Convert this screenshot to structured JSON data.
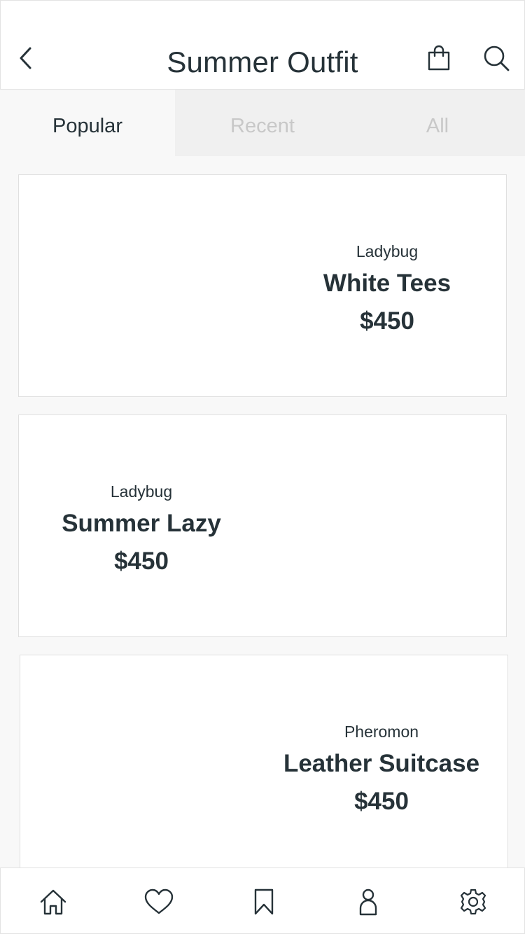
{
  "header": {
    "title": "Summer Outfit",
    "back_icon": "chevron-left-icon",
    "bag_icon": "shopping-bag-icon",
    "search_icon": "search-icon"
  },
  "tabs": [
    {
      "label": "Popular",
      "active": true
    },
    {
      "label": "Recent",
      "active": false
    },
    {
      "label": "All",
      "active": false
    }
  ],
  "products": [
    {
      "brand": "Ladybug",
      "name": "White Tees",
      "price": "$450"
    },
    {
      "brand": "Ladybug",
      "name": "Summer Lazy",
      "price": "$450"
    },
    {
      "brand": "Pheromon",
      "name": "Leather Suitcase",
      "price": "$450"
    }
  ],
  "bottom_nav": [
    {
      "icon": "home-icon"
    },
    {
      "icon": "heart-icon"
    },
    {
      "icon": "bookmark-icon"
    },
    {
      "icon": "user-icon"
    },
    {
      "icon": "settings-icon"
    }
  ],
  "colors": {
    "text": "#263238",
    "inactive_tab_text": "#c8c8c8",
    "background": "#f8f8f8"
  }
}
